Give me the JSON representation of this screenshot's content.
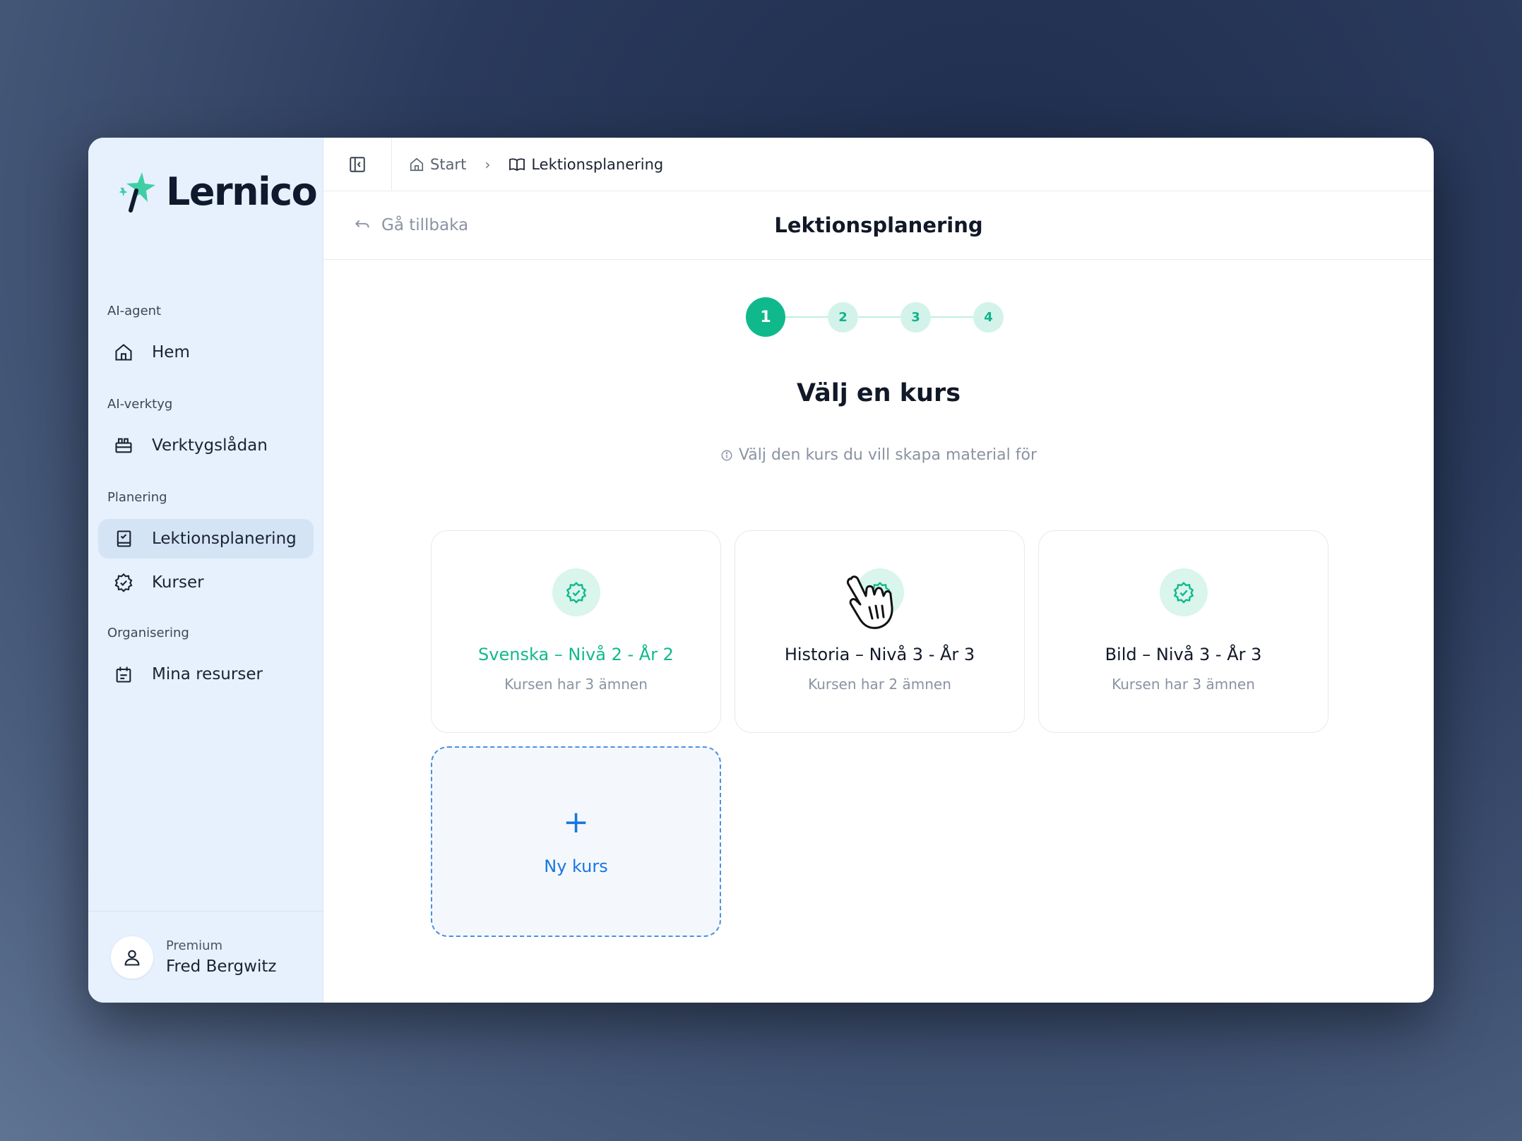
{
  "brand": {
    "name": "Lernico",
    "accent": "#10b98c",
    "link_color": "#1976e0"
  },
  "sidebar": {
    "sections": [
      {
        "heading": "AI-agent",
        "items": [
          {
            "label": "Hem",
            "icon": "home-icon"
          }
        ]
      },
      {
        "heading": "AI-verktyg",
        "items": [
          {
            "label": "Verktygslådan",
            "icon": "toolbox-icon"
          }
        ]
      },
      {
        "heading": "Planering",
        "items": [
          {
            "label": "Lektionsplanering",
            "icon": "notebook-icon",
            "active": true
          },
          {
            "label": "Kurser",
            "icon": "badge-check-icon"
          }
        ]
      },
      {
        "heading": "Organisering",
        "items": [
          {
            "label": "Mina resurser",
            "icon": "calendar-box-icon"
          }
        ]
      }
    ],
    "user": {
      "plan": "Premium",
      "name": "Fred Bergwitz",
      "icon": "user-icon"
    }
  },
  "topbar": {
    "toggle_icon": "sidebar-toggle-icon",
    "breadcrumb": [
      {
        "label": "Start",
        "icon": "home-icon"
      },
      {
        "label": "Lektionsplanering",
        "icon": "book-open-icon"
      }
    ]
  },
  "header": {
    "back_label": "Gå tillbaka",
    "title": "Lektionsplanering"
  },
  "stepper": {
    "steps": [
      "1",
      "2",
      "3",
      "4"
    ],
    "current": 1
  },
  "content": {
    "heading": "Välj en kurs",
    "hint": "Välj den kurs du vill skapa material för",
    "courses": [
      {
        "title": "Svenska – Nivå 2 - År 2",
        "subtitle": "Kursen har 3 ämnen",
        "selected": true
      },
      {
        "title": "Historia – Nivå 3 - År 3",
        "subtitle": "Kursen har 2 ämnen",
        "selected": false
      },
      {
        "title": "Bild – Nivå 3 - År 3",
        "subtitle": "Kursen har 3 ämnen",
        "selected": false
      }
    ],
    "new_course": {
      "symbol": "+",
      "label": "Ny kurs"
    }
  }
}
